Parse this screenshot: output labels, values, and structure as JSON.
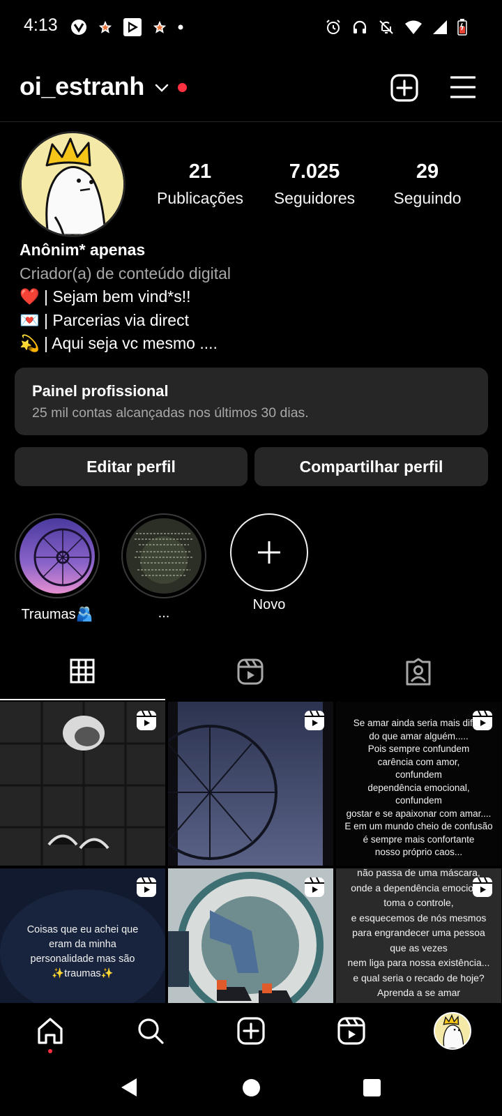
{
  "status_bar": {
    "time": "4:13"
  },
  "header": {
    "username": "oi_estranh"
  },
  "profile": {
    "stats": [
      {
        "value": "21",
        "label": "Publicações"
      },
      {
        "value": "7.025",
        "label": "Seguidores"
      },
      {
        "value": "29",
        "label": "Seguindo"
      }
    ],
    "name": "Anônim* apenas",
    "category": "Criador(a) de conteúdo digital",
    "bio_lines": [
      {
        "emoji": "❤️",
        "text": " | Sejam bem vind*s!!"
      },
      {
        "emoji": "💌",
        "text": " | Parcerias via direct"
      },
      {
        "emoji": "💫",
        "text": " | Aqui seja vc mesmo ...."
      }
    ]
  },
  "panel": {
    "title": "Painel profissional",
    "subtitle": "25 mil contas alcançadas nos últimos 30 dias."
  },
  "buttons": {
    "edit": "Editar perfil",
    "share": "Compartilhar perfil"
  },
  "highlights": [
    {
      "label": "Traumas🫂"
    },
    {
      "label": "..."
    },
    {
      "label": "Novo"
    }
  ],
  "grid": {
    "post3_text": "Se amar ainda seria mais difícil\ndo que amar alguém.....\nPois sempre confundem\ncarência com amor,\nconfundem\ndependência emocional,\nconfundem\ngostar e se apaixonar com amar....\nE em um mundo cheio de confusão\né sempre mais confortante\nnosso próprio caos...",
    "post4_text": "Coisas que eu achei que\neram da minha\npersonalidade mas são\n✨traumas✨",
    "post6_text": "não passa de uma máscara,\nonde a dependência emocional\ntoma o controle,\ne esquecemos de nós mesmos\npara engrandecer uma pessoa\nque as vezes\nnem liga para nossa existência...\ne qual seria o recado de hoje?\nAprenda a se amar\nantes msm de pensar em"
  }
}
